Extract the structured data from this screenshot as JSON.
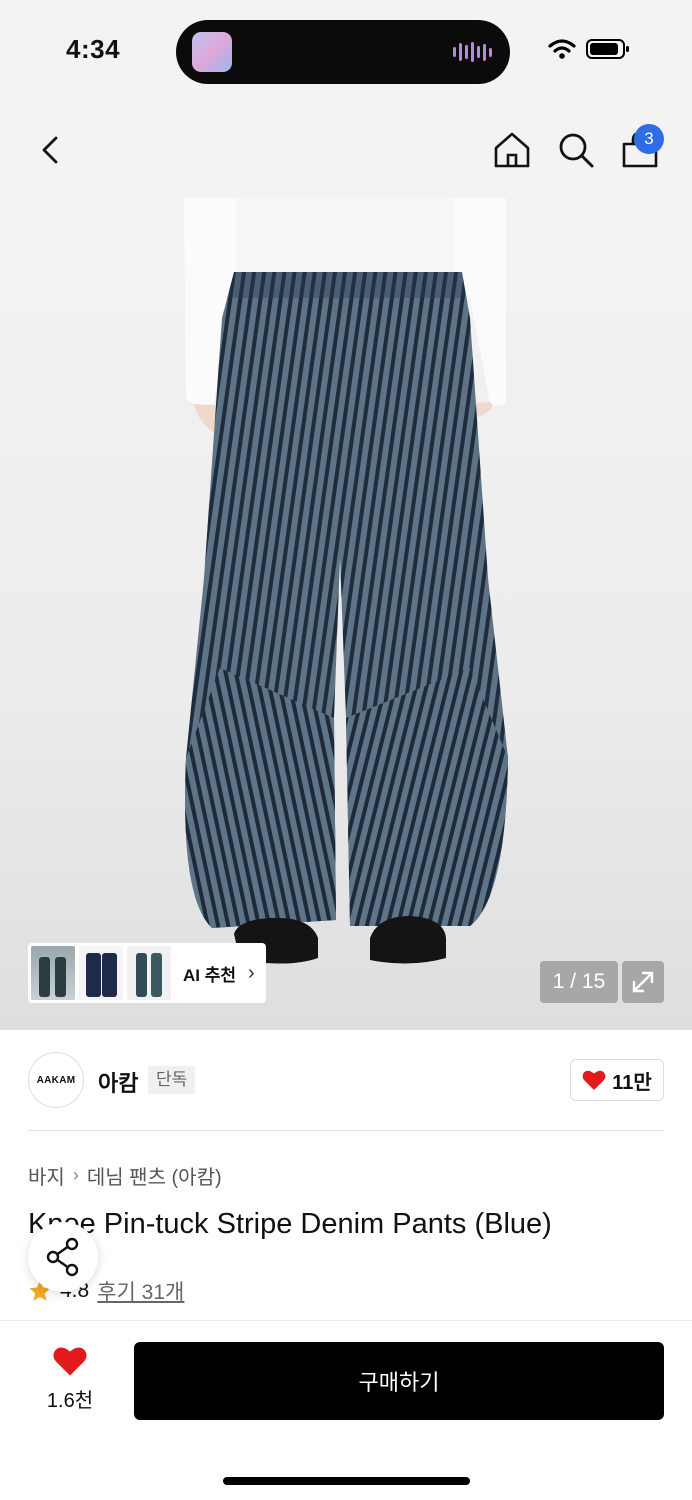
{
  "status_bar": {
    "time": "4:34"
  },
  "nav": {
    "cart_count": "3"
  },
  "gallery": {
    "ai_label": "AI 추천",
    "counter": "1 / 15"
  },
  "brand": {
    "logo_text": "AAKAM",
    "name": "아캄",
    "badge": "단독",
    "likes": "11만"
  },
  "breadcrumb": {
    "category": "바지",
    "subcategory": "데님 팬츠 (아캄)"
  },
  "product": {
    "title": "Knee Pin-tuck Stripe Denim Pants (Blue)",
    "rating": "4.8",
    "reviews": "후기 31개"
  },
  "bottom": {
    "like_count": "1.6천",
    "buy_label": "구매하기"
  },
  "colors": {
    "accent_blue": "#2f6de6",
    "heart_red": "#e4191c",
    "star": "#f5a623"
  },
  "icons": [
    "back-arrow-icon",
    "home-icon",
    "search-icon",
    "shopping-bag-icon",
    "expand-icon",
    "heart-icon",
    "share-icon",
    "star-icon",
    "wifi-icon",
    "battery-icon",
    "chevron-right-icon"
  ]
}
